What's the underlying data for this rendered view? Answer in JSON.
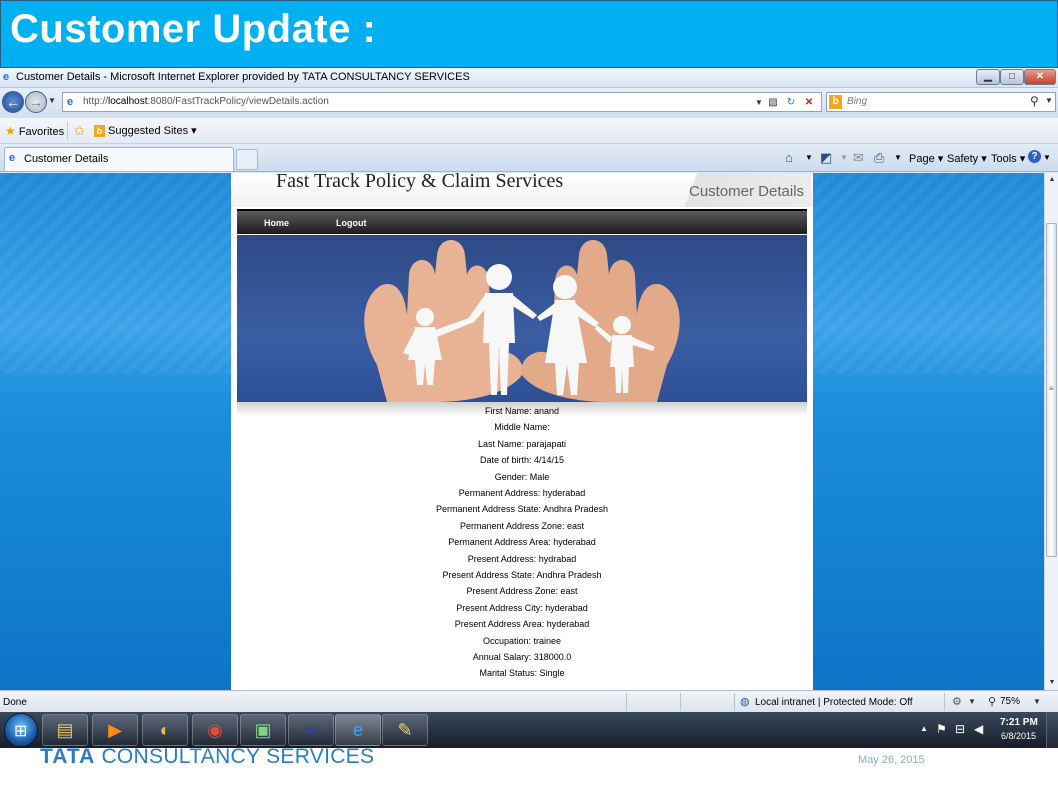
{
  "slide": {
    "title": "Customer Update :",
    "footer_brand_strong": "TATA",
    "footer_brand_rest": " CONSULTANCY SERVICES",
    "footer_date": "May 26, 2015"
  },
  "browser": {
    "window_title": "Customer Details - Microsoft Internet Explorer provided by TATA CONSULTANCY SERVICES",
    "address_prefix": "http://",
    "address_host": "localhost",
    "address_rest": ":8080/FastTrackPolicy/viewDetails.action",
    "search_placeholder": "Bing",
    "favorites_label": "Favorites",
    "suggested_sites_label": "Suggested Sites ▾",
    "tab_label": "Customer Details",
    "command_bar": {
      "page": "Page ▾",
      "safety": "Safety ▾",
      "tools": "Tools ▾"
    },
    "status_text": "Done",
    "zone_text": "Local intranet | Protected Mode: Off",
    "zoom_text": "75%"
  },
  "page": {
    "site_title": "Fast Track Policy & Claim Services",
    "page_name": "Customer Details",
    "nav": {
      "home": "Home",
      "logout": "Logout"
    },
    "details": [
      "First Name: anand",
      "Middle Name:",
      "Last Name: parajapati",
      "Date of birth: 4/14/15",
      "Gender: Male",
      "Permanent Address: hyderabad",
      "Permanent Address State: Andhra Pradesh",
      "Permanent Address Zone: east",
      "Permanent Address Area: hyderabad",
      "Present Address: hydrabad",
      "Present Address State: Andhra Pradesh",
      "Present Address Zone: east",
      "Present Address City: hyderabad",
      "Present Address Area: hyderabad",
      "Occupation: trainee",
      "Annual Salary: 318000.0",
      "Marital Status: Single"
    ]
  },
  "taskbar": {
    "clock_time": "7:21 PM",
    "clock_date": "6/8/2015",
    "pinned_icons": [
      "explorer-icon",
      "media-player-icon",
      "paint-icon",
      "chrome-icon",
      "terminal-icon",
      "eclipse-icon",
      "internet-explorer-icon",
      "paintbrush-icon"
    ]
  },
  "colors": {
    "slide_header": "#00b0f0",
    "brand_blue": "#2a7dc4",
    "page_background": "#1b8edc"
  }
}
